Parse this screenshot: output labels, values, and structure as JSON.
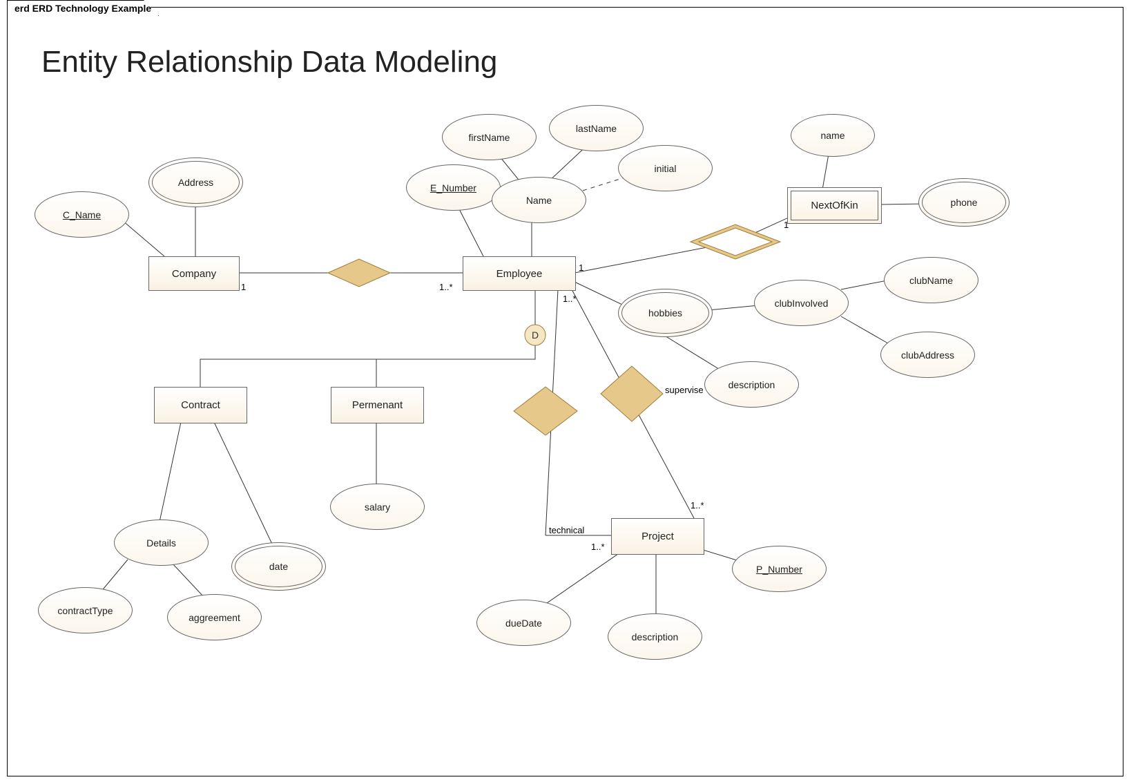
{
  "frame": {
    "tab": "erd ERD Technology Example"
  },
  "title": "Entity Relationship Data Modeling",
  "entities": {
    "company": "Company",
    "employee": "Employee",
    "contract": "Contract",
    "permanent": "Permenant",
    "project": "Project",
    "nextOfKin": "NextOfKin"
  },
  "attributes": {
    "cName": "C_Name",
    "address": "Address",
    "eNumber": "E_Number",
    "firstName": "firstName",
    "lastName": "lastName",
    "initial": "initial",
    "name": "Name",
    "kinName": "name",
    "phone": "phone",
    "hobbies": "hobbies",
    "clubInvolved": "clubInvolved",
    "clubName": "clubName",
    "clubAddress": "clubAddress",
    "hobbyDesc": "description",
    "details": "Details",
    "contractType": "contractType",
    "aggreement": "aggreement",
    "date": "date",
    "salary": "salary",
    "dueDate": "dueDate",
    "projDesc": "description",
    "pNumber": "P_Number"
  },
  "cardinalities": {
    "company_employee_left": "1",
    "company_employee_right": "1..*",
    "employee_nextOfKin_left": "1",
    "employee_nextOfKin_right": "1",
    "employee_project_top": "1..*",
    "project_technical": "1..*",
    "project_supervise": "1..*"
  },
  "labels": {
    "disjoint": "D",
    "technical": "technical",
    "supervise": "supervise"
  }
}
